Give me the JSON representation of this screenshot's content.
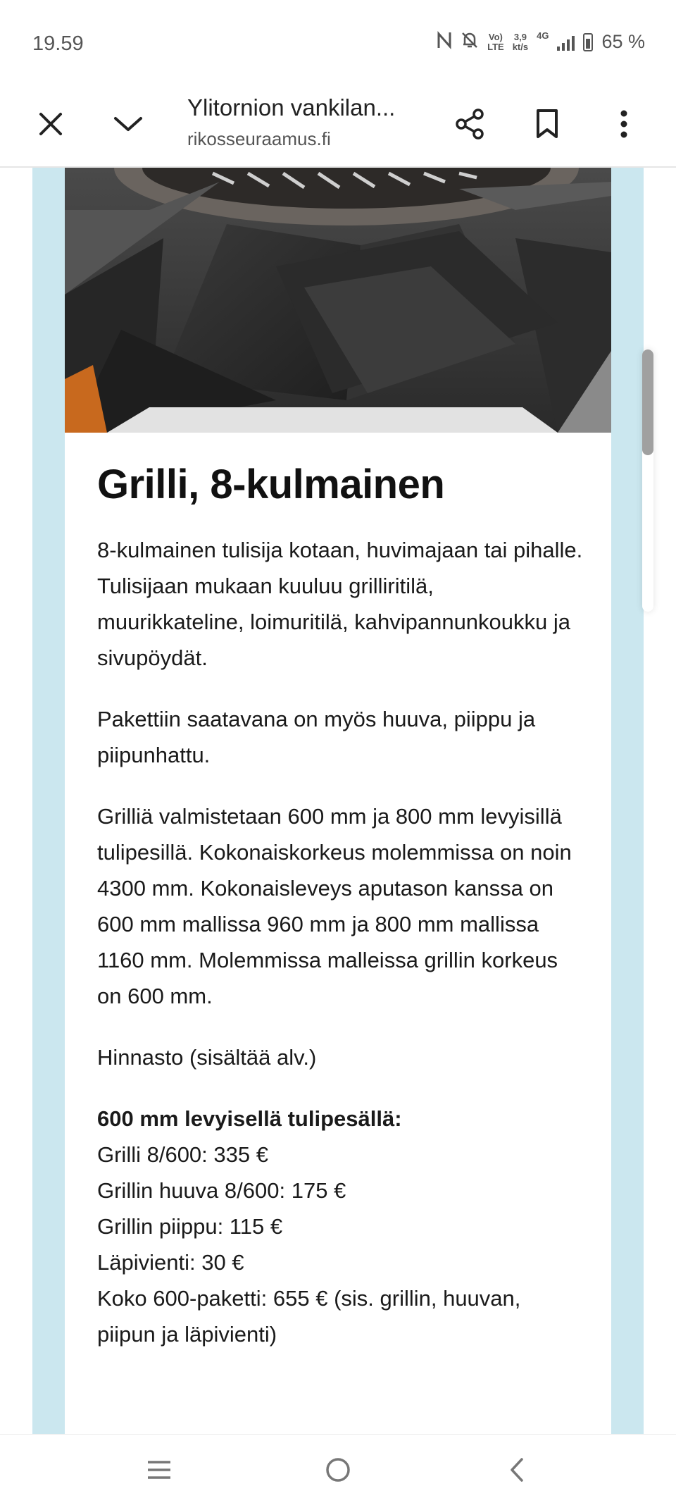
{
  "status_bar": {
    "time": "19.59",
    "volte_top": "Vo)",
    "volte_bottom": "LTE",
    "speed_top": "3,9",
    "speed_bottom": "kt/s",
    "network": "4G",
    "battery": "65 %"
  },
  "toolbar": {
    "title": "Ylitornion vankilan...",
    "url": "rikosseuraamus.fi",
    "close_icon": "close-icon",
    "collapse_icon": "chevron-down-icon",
    "share_icon": "share-icon",
    "bookmark_icon": "bookmark-icon",
    "menu_icon": "more-vert-icon"
  },
  "article": {
    "heading": "Grilli, 8-kulmainen",
    "paragraphs": [
      "8-kulmainen tulisija kotaan, huvimajaan tai pihalle. Tulisijaan mukaan kuuluu grilliritilä, muurikkateline, loimuritilä, kahvipannunkoukku ja sivupöydät.",
      "Pakettiin saatavana on myös huuva, piippu ja piipunhattu.",
      "Grilliä valmistetaan 600 mm ja 800 mm levyisillä tulipesillä. Kokonaiskorkeus molemmissa on noin 4300 mm. Kokonaisleveys aputason kanssa on 600 mm mallissa 960 mm ja 800 mm mallissa 1160 mm. Molemmissa malleissa grillin korkeus on 600 mm.",
      "Hinnasto (sisältää alv.)"
    ],
    "price_heading": "600 mm levyisellä tulipesällä:",
    "price_lines": [
      "Grilli 8/600: 335 €",
      "Grillin huuva 8/600: 175 €",
      "Grillin piippu: 115 €",
      "Läpivienti: 30 €",
      "Koko 600-paketti: 655 € (sis. grillin, huuvan, piipun ja läpivienti)"
    ]
  },
  "nav_bar": {
    "recent_icon": "recent-apps-icon",
    "home_icon": "home-icon",
    "back_icon": "back-icon"
  },
  "colors": {
    "page_background": "#cbe7ef",
    "card_background": "#ffffff",
    "text": "#111111"
  }
}
